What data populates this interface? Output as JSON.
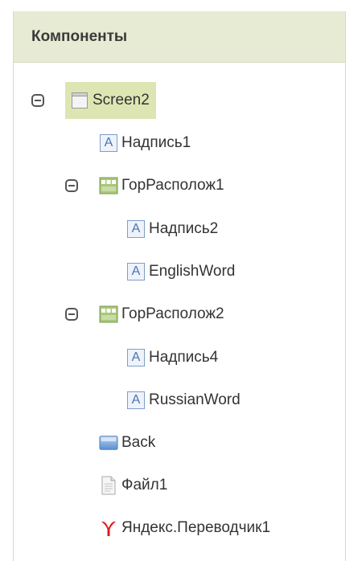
{
  "panel": {
    "title": "Компоненты"
  },
  "tree": {
    "screen": "Screen2",
    "label1": "Надпись1",
    "hor1": "ГорРасполож1",
    "label2": "Надпись2",
    "english": "EnglishWord",
    "hor2": "ГорРасполож2",
    "label4": "Надпись4",
    "russian": "RussianWord",
    "back": "Back",
    "file": "Файл1",
    "translator": "Яндекс.Переводчик1"
  },
  "icons": {
    "label_glyph": "A",
    "screen": "screen-icon",
    "label": "label-icon",
    "horizontal_arrangement": "horizontal-arrangement-icon",
    "button": "button-icon",
    "file": "file-icon",
    "yandex": "yandex-translate-icon"
  },
  "colors": {
    "header_bg": "#e7ebd3",
    "selected_bg": "#dde6b3",
    "yandex_red": "#e01b1b"
  }
}
